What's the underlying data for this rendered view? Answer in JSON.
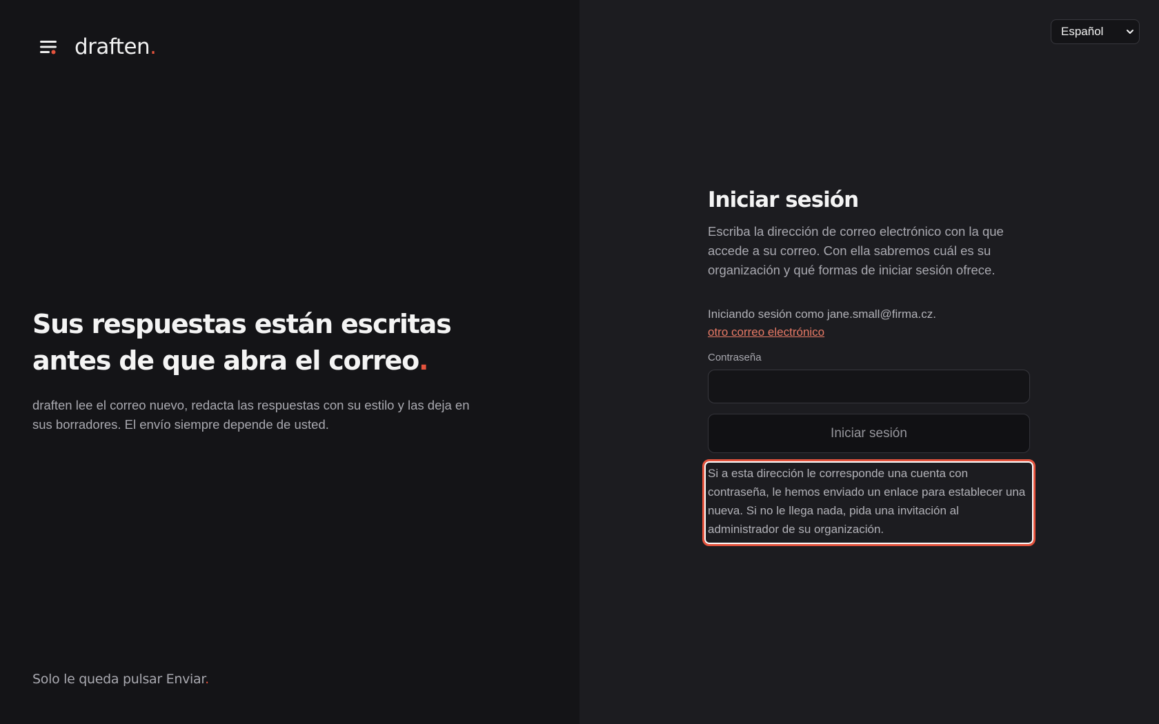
{
  "brand": {
    "name": "draften",
    "dot": ".",
    "accent_color": "#e5533d"
  },
  "hero": {
    "title": "Sus respuestas están escritas antes de que abra el correo",
    "title_dot": ".",
    "subtitle": "draften lee el correo nuevo, redacta las respuestas con su estilo y las deja en sus borradores. El envío siempre depende de usted."
  },
  "footer": {
    "tagline": "Solo le queda pulsar Enviar",
    "tagline_dot": "."
  },
  "language": {
    "selected": "Español"
  },
  "login": {
    "title": "Iniciar sesión",
    "description": "Escriba la dirección de correo electrónico con la que accede a su correo. Con ella sabremos cuál es su organización y qué formas de iniciar sesión ofrece.",
    "signed_in_as": "Iniciando sesión como jane.small@firma.cz.",
    "other_email_link": "otro correo electrónico",
    "password_label": "Contraseña",
    "password_value": "",
    "submit_label": "Iniciar sesión",
    "notice": "Si a esta dirección le corresponde una cuenta con contraseña, le hemos enviado un enlace para establecer una nueva. Si no le llega nada, pida una invitación al administrador de su organización."
  },
  "icons": {
    "logo": "menu-lines-icon",
    "language_chevron": "chevron-down-icon"
  }
}
